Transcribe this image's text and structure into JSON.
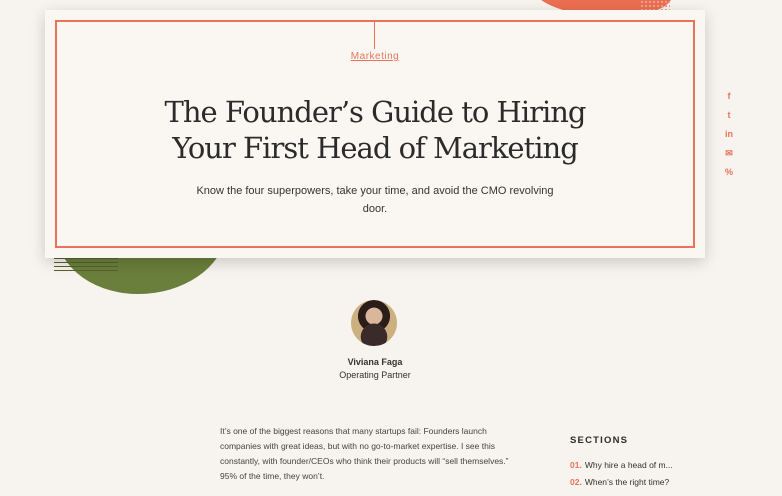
{
  "article": {
    "category": "Marketing",
    "title_line1": "The Founder’s Guide to Hiring",
    "title_line2": "Your First Head of Marketing",
    "subtitle": "Know the four superpowers, take your time, and avoid the CMO revolving door."
  },
  "share": {
    "icons": [
      "facebook-icon",
      "twitter-icon",
      "linkedin-icon",
      "email-icon",
      "link-icon"
    ],
    "glyphs": [
      "f",
      "t",
      "in",
      "✉",
      "%"
    ]
  },
  "author": {
    "name": "Viviana Faga",
    "role": "Operating Partner"
  },
  "body": {
    "paragraph": "It’s one of the biggest reasons that many startups fail: Founders launch companies with great ideas, but with no go-to-market expertise. I see this constantly, with founder/CEOs who think their products will “sell themselves.” 95% of the time, they won’t."
  },
  "sections": {
    "title": "SECTIONS",
    "items": [
      {
        "num": "01.",
        "label": "Why hire a head of m..."
      },
      {
        "num": "02.",
        "label": "When’s the right time?"
      }
    ]
  },
  "colors": {
    "accent": "#e9735a",
    "background": "#f7f3ee",
    "green": "#6a7f3b"
  }
}
